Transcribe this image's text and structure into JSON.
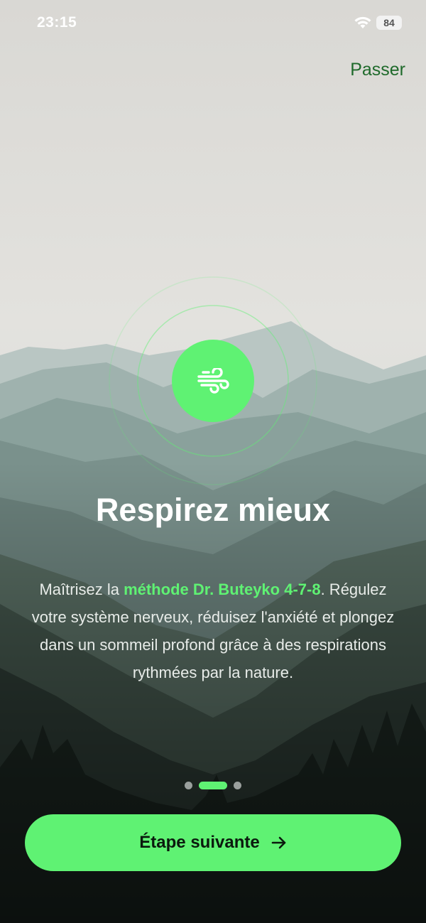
{
  "status_bar": {
    "time": "23:15",
    "battery": "84"
  },
  "header": {
    "skip_label": "Passer"
  },
  "hero": {
    "icon": "wind-icon",
    "title": "Respirez mieux"
  },
  "description": {
    "before": "Maîtrisez la ",
    "highlight": "méthode Dr. Buteyko 4-7-8",
    "after": ". Régulez votre système nerveux, réduisez l'anxiété et plongez dans un sommeil profond grâce à des respirations rythmées par la nature."
  },
  "pagination": {
    "total": 3,
    "active_index": 1
  },
  "cta": {
    "label": "Étape suivante",
    "icon": "arrow-right-icon"
  },
  "colors": {
    "accent": "#5ff273",
    "skip_text": "#1f6a2b",
    "cta_text": "#0b1a0e"
  }
}
